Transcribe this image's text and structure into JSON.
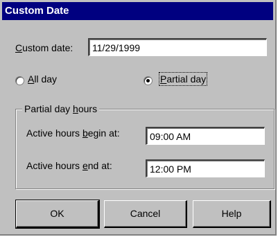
{
  "dialog": {
    "title": "Custom Date"
  },
  "custom_date": {
    "label_accel": "C",
    "label_rest": "ustom date:",
    "value": "11/29/1999"
  },
  "options": {
    "all_day": {
      "accel": "A",
      "rest": "ll day",
      "selected": false
    },
    "partial_day": {
      "accel": "P",
      "rest": "artial day",
      "selected": true
    }
  },
  "partial_hours": {
    "group_pre": "Partial day ",
    "group_accel": "h",
    "group_post": "ours",
    "begin": {
      "pre": "Active hours ",
      "accel": "b",
      "post": "egin at:",
      "value": "09:00 AM"
    },
    "end": {
      "pre": "Active hours ",
      "accel": "e",
      "post": "nd at:",
      "value": "12:00 PM"
    }
  },
  "buttons": {
    "ok": "OK",
    "cancel": "Cancel",
    "help": "Help"
  }
}
